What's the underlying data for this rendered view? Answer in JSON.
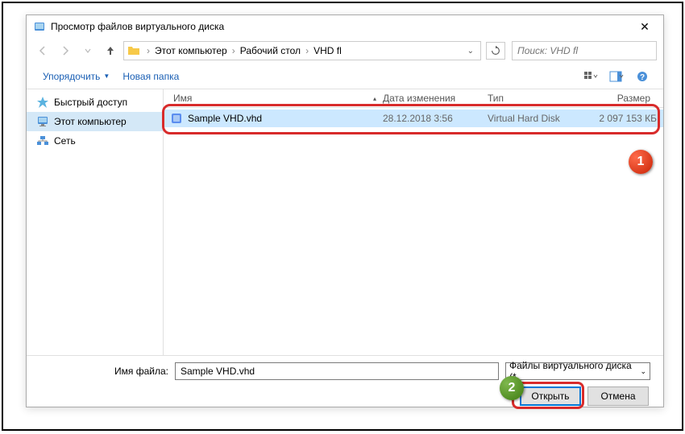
{
  "titlebar": {
    "title": "Просмотр файлов виртуального диска"
  },
  "breadcrumb": {
    "items": [
      "Этот компьютер",
      "Рабочий стол",
      "VHD fl"
    ]
  },
  "search": {
    "placeholder": "Поиск: VHD fl"
  },
  "toolbar": {
    "organize": "Упорядочить",
    "newfolder": "Новая папка"
  },
  "sidebar": {
    "items": [
      {
        "label": "Быстрый доступ",
        "icon": "star"
      },
      {
        "label": "Этот компьютер",
        "icon": "pc"
      },
      {
        "label": "Сеть",
        "icon": "network"
      }
    ],
    "selected": 1
  },
  "columns": {
    "name": "Имя",
    "date": "Дата изменения",
    "type": "Тип",
    "size": "Размер"
  },
  "files": [
    {
      "name": "Sample VHD.vhd",
      "date": "28.12.2018 3:56",
      "type": "Virtual Hard Disk",
      "size": "2 097 153 КБ",
      "selected": true
    }
  ],
  "bottom": {
    "filename_label": "Имя файла:",
    "filename_value": "Sample VHD.vhd",
    "filetype": "Файлы виртуального диска (*",
    "open": "Открыть",
    "cancel": "Отмена"
  },
  "badges": {
    "b1": "1",
    "b2": "2"
  }
}
